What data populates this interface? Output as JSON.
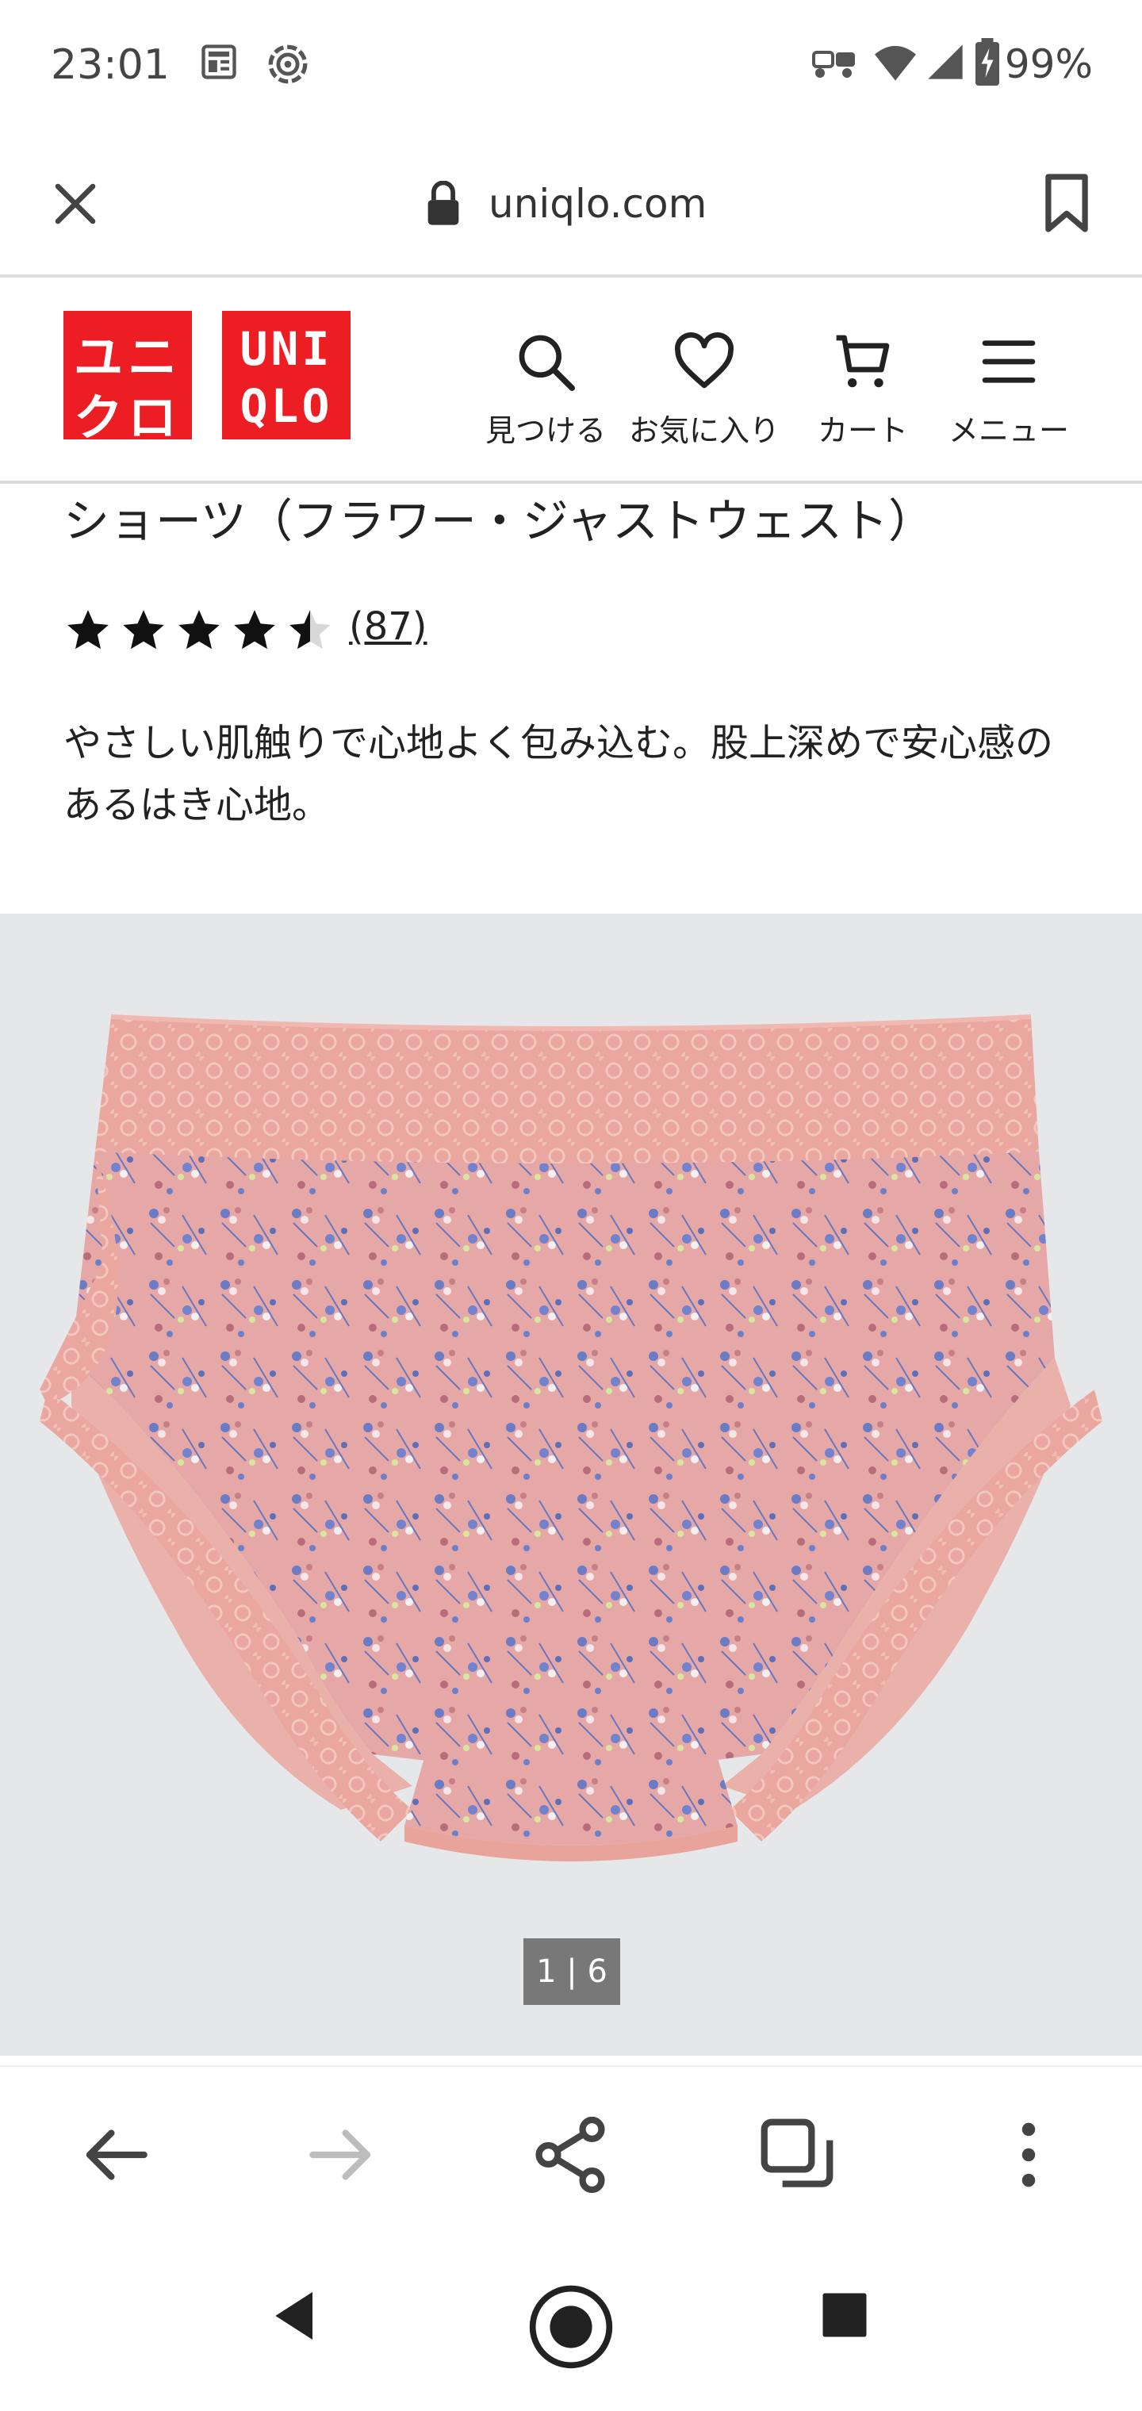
{
  "status_bar": {
    "time": "23:01",
    "battery": "99%",
    "icons": [
      "news-icon",
      "hotspot-icon",
      "vpn-key-icon",
      "wifi-icon",
      "signal-icon",
      "battery-charging-icon"
    ]
  },
  "url_bar": {
    "url": "uniqlo.com",
    "icons": [
      "close-icon",
      "lock-icon",
      "bookmark-icon"
    ]
  },
  "header": {
    "logo_katakana_top": "ユニ",
    "logo_katakana_bottom": "クロ",
    "logo_latin_top": "UNI",
    "logo_latin_bottom": "QLO",
    "nav": [
      {
        "label": "見つける",
        "icon": "search-icon"
      },
      {
        "label": "お気に入り",
        "icon": "heart-icon"
      },
      {
        "label": "カート",
        "icon": "cart-icon"
      },
      {
        "label": "メニュー",
        "icon": "menu-icon"
      }
    ],
    "brand_color": "#ed1d24"
  },
  "product": {
    "title": "ショーツ（フラワー・ジャストウェスト）",
    "rating": 4.5,
    "rating_count": "(87)",
    "description": "やさしい肌触りで心地よく包み込む。股上深めで安心感のあるはき心地。"
  },
  "gallery": {
    "counter": "1 | 6",
    "current": 1,
    "total": 6
  },
  "browser_toolbar": {
    "icons": [
      "back-arrow-icon",
      "forward-arrow-icon",
      "share-icon",
      "tabs-icon",
      "more-vert-icon"
    ]
  },
  "system_nav": {
    "icons": [
      "nav-back-icon",
      "nav-home-icon",
      "nav-recents-icon"
    ]
  }
}
